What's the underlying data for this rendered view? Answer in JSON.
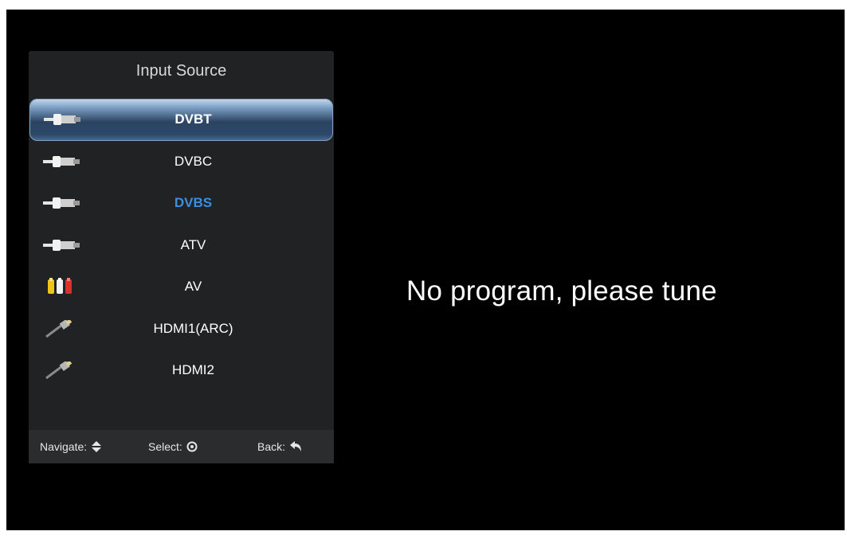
{
  "panel": {
    "title": "Input Source",
    "items": [
      {
        "label": "DVBT",
        "icon": "coax-connector-icon",
        "state": "highlighted"
      },
      {
        "label": "DVBC",
        "icon": "coax-connector-icon",
        "state": "normal"
      },
      {
        "label": "DVBS",
        "icon": "coax-connector-icon",
        "state": "active"
      },
      {
        "label": "ATV",
        "icon": "coax-connector-icon",
        "state": "normal"
      },
      {
        "label": "AV",
        "icon": "rca-connector-icon",
        "state": "normal"
      },
      {
        "label": "HDMI1(ARC)",
        "icon": "hdmi-cable-icon",
        "state": "normal"
      },
      {
        "label": "HDMI2",
        "icon": "hdmi-cable-icon",
        "state": "normal"
      }
    ],
    "footer": {
      "navigate_label": "Navigate:",
      "navigate_icon": "up-down-arrow-icon",
      "select_label": "Select:",
      "select_icon": "ok-circle-icon",
      "back_label": "Back:",
      "back_icon": "back-arrow-icon"
    }
  },
  "message": "No program, please tune",
  "colors": {
    "background": "#000000",
    "panel": "#202223",
    "highlight": "#2c4462",
    "active_text": "#3b8ee0"
  }
}
